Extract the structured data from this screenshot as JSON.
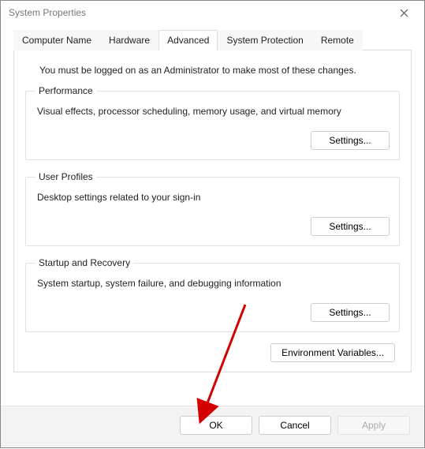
{
  "window": {
    "title": "System Properties",
    "close_label": "Close"
  },
  "tabs": {
    "computer_name": "Computer Name",
    "hardware": "Hardware",
    "advanced": "Advanced",
    "system_protection": "System Protection",
    "remote": "Remote"
  },
  "advanced_page": {
    "intro": "You must be logged on as an Administrator to make most of these changes.",
    "performance": {
      "legend": "Performance",
      "desc": "Visual effects, processor scheduling, memory usage, and virtual memory",
      "button": "Settings..."
    },
    "user_profiles": {
      "legend": "User Profiles",
      "desc": "Desktop settings related to your sign-in",
      "button": "Settings..."
    },
    "startup_recovery": {
      "legend": "Startup and Recovery",
      "desc": "System startup, system failure, and debugging information",
      "button": "Settings..."
    },
    "environment_variables": "Environment Variables..."
  },
  "footer": {
    "ok": "OK",
    "cancel": "Cancel",
    "apply": "Apply"
  },
  "annotation": {
    "arrow_color": "#d40000"
  }
}
